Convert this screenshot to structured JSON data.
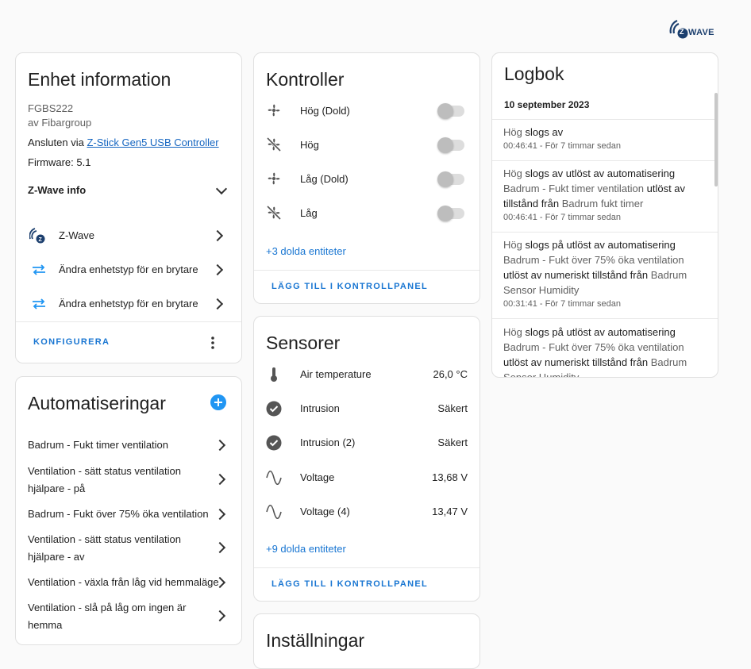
{
  "logo": {
    "text": "WAVE",
    "badge": "Z"
  },
  "device_info": {
    "title": "Enhet information",
    "model": "FGBS222",
    "manufacturer": "av Fibargroup",
    "connected_prefix": "Ansluten via",
    "connected_link": "Z-Stick Gen5 USB Controller",
    "firmware": "Firmware: 5.1",
    "zwave_info_label": "Z-Wave info",
    "items": [
      {
        "label": "Z-Wave",
        "icon": "zwave-icon"
      },
      {
        "label": "Ändra enhetstyp för en brytare",
        "icon": "swap-icon"
      },
      {
        "label": "Ändra enhetstyp för en brytare",
        "icon": "swap-icon"
      }
    ],
    "configure_label": "KONFIGURERA"
  },
  "automations": {
    "title": "Automatiseringar",
    "items": [
      {
        "l1": "Badrum - Fukt timer ventilation",
        "l2": ""
      },
      {
        "l1": "Ventilation - sätt status ventilation",
        "l2": "hjälpare - på"
      },
      {
        "l1": "Badrum - Fukt över 75% öka ventilation",
        "l2": ""
      },
      {
        "l1": "Ventilation - sätt status ventilation",
        "l2": "hjälpare - av"
      },
      {
        "l1": "Ventilation - växla från låg vid hemmaläge",
        "l2": ""
      },
      {
        "l1": "Ventilation - slå på låg om ingen är",
        "l2": "hemma"
      }
    ]
  },
  "controls": {
    "title": "Kontroller",
    "items": [
      {
        "label": "Hög (Dold)",
        "icon": "fan-icon",
        "on": false
      },
      {
        "label": "Hög",
        "icon": "fan-off-icon",
        "on": false
      },
      {
        "label": "Låg (Dold)",
        "icon": "fan-icon",
        "on": false
      },
      {
        "label": "Låg",
        "icon": "fan-off-icon",
        "on": false
      }
    ],
    "hidden_link": "+3 dolda entiteter",
    "add_label": "LÄGG TILL I KONTROLLPANEL"
  },
  "sensors": {
    "title": "Sensorer",
    "items": [
      {
        "label": "Air temperature",
        "value": "26,0 °C",
        "icon": "thermometer-icon"
      },
      {
        "label": "Intrusion",
        "value": "Säkert",
        "icon": "check-circle-icon"
      },
      {
        "label": "Intrusion (2)",
        "value": "Säkert",
        "icon": "check-circle-icon"
      },
      {
        "label": "Voltage",
        "value": "13,68 V",
        "icon": "sine-wave-icon"
      },
      {
        "label": "Voltage (4)",
        "value": "13,47 V",
        "icon": "sine-wave-icon"
      }
    ],
    "hidden_link": "+9 dolda entiteter",
    "add_label": "LÄGG TILL I KONTROLLPANEL"
  },
  "settings": {
    "title": "Inställningar"
  },
  "logbook": {
    "title": "Logbok",
    "date": "10 september 2023",
    "entries": [
      {
        "parts": [
          [
            "Hög",
            "g"
          ],
          [
            " slogs av",
            ""
          ]
        ],
        "time": "00:46:41 - För 7 timmar sedan"
      },
      {
        "parts": [
          [
            "Hög",
            "g"
          ],
          [
            " slogs av utlöst av automatisering ",
            ""
          ],
          [
            "Badrum - Fukt timer ventilation",
            "g"
          ],
          [
            " utlöst av tillstånd från ",
            ""
          ],
          [
            "Badrum fukt timer",
            "g"
          ]
        ],
        "time": "00:46:41 - För 7 timmar sedan"
      },
      {
        "parts": [
          [
            "Hög",
            "g"
          ],
          [
            " slogs på utlöst av automatisering ",
            ""
          ],
          [
            "Badrum - Fukt över 75% öka ventilation",
            "g"
          ],
          [
            " utlöst av numeriskt tillstånd från ",
            ""
          ],
          [
            "Badrum Sensor Humidity",
            "g"
          ]
        ],
        "time": "00:31:41 - För 7 timmar sedan"
      },
      {
        "parts": [
          [
            "Hög",
            "g"
          ],
          [
            " slogs på utlöst av automatisering ",
            ""
          ],
          [
            "Badrum - Fukt över 75% öka ventilation",
            "g"
          ],
          [
            " utlöst av numeriskt tillstånd från ",
            ""
          ],
          [
            "Badrum Sensor Humidity",
            "g"
          ]
        ],
        "time": ""
      }
    ]
  }
}
